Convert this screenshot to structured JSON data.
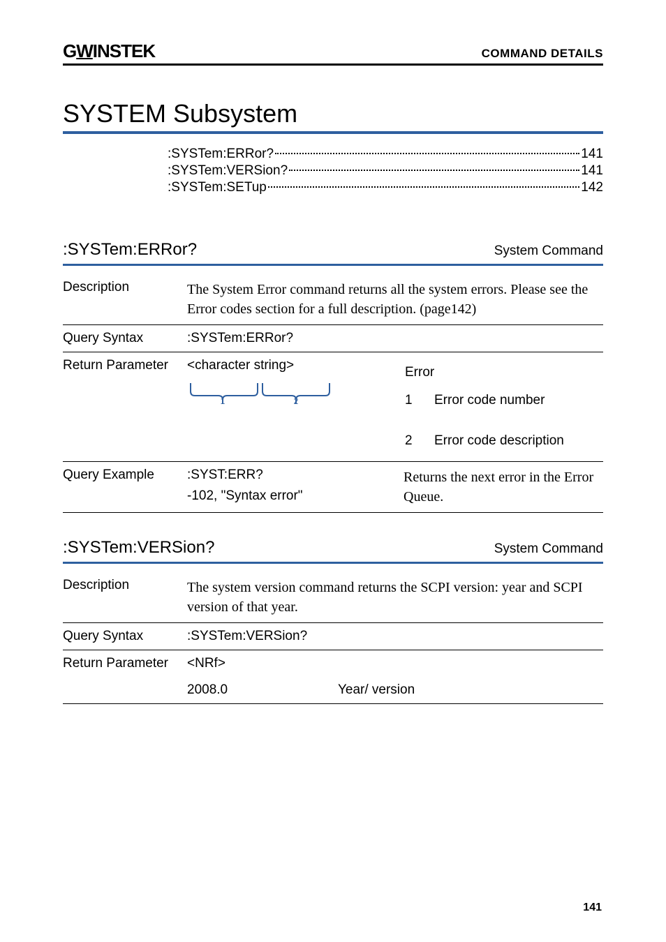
{
  "header": {
    "logo_pre": "G",
    "logo_u": "W",
    "logo_post": "INSTEK",
    "right": "COMMAND DETAILS"
  },
  "title": "SYSTEM Subsystem",
  "toc": [
    {
      "label": ":SYSTem:ERRor?",
      "page": "141"
    },
    {
      "label": ":SYSTem:VERSion?",
      "page": "141"
    },
    {
      "label": ":SYSTem:SETup",
      "page": "142"
    }
  ],
  "cmd1": {
    "name": ":SYSTem:ERRor?",
    "type": "System Command",
    "descLabel": "Description",
    "desc": "The System Error command returns all the system errors. Please see the Error codes section for a full description. (page142)",
    "querySyntaxLabel": "Query Syntax",
    "querySyntax": ":SYSTem:ERRor?",
    "returnParamLabel": "Return Parameter",
    "returnParamVal": "<character string>",
    "errorHeader": "Error",
    "err1num": "1",
    "err1txt": "Error code number",
    "err2num": "2",
    "err2txt": "Error code description",
    "queryExampleLabel": "Query Example",
    "queryExample1": ":SYST:ERR?",
    "queryExample2": "-102, \"Syntax error\"",
    "queryExampleDesc": "Returns the next error in the Error Queue."
  },
  "cmd2": {
    "name": ":SYSTem:VERSion?",
    "type": "System Command",
    "descLabel": "Description",
    "desc": "The system version command returns the SCPI version: year and SCPI version of that year.",
    "querySyntaxLabel": "Query Syntax",
    "querySyntax": ":SYSTem:VERSion?",
    "returnParamLabel": "Return Parameter",
    "returnParamVal": "<NRf>",
    "exampleVal": "2008.0",
    "exampleDesc": "Year/ version"
  },
  "pagenum": "141"
}
